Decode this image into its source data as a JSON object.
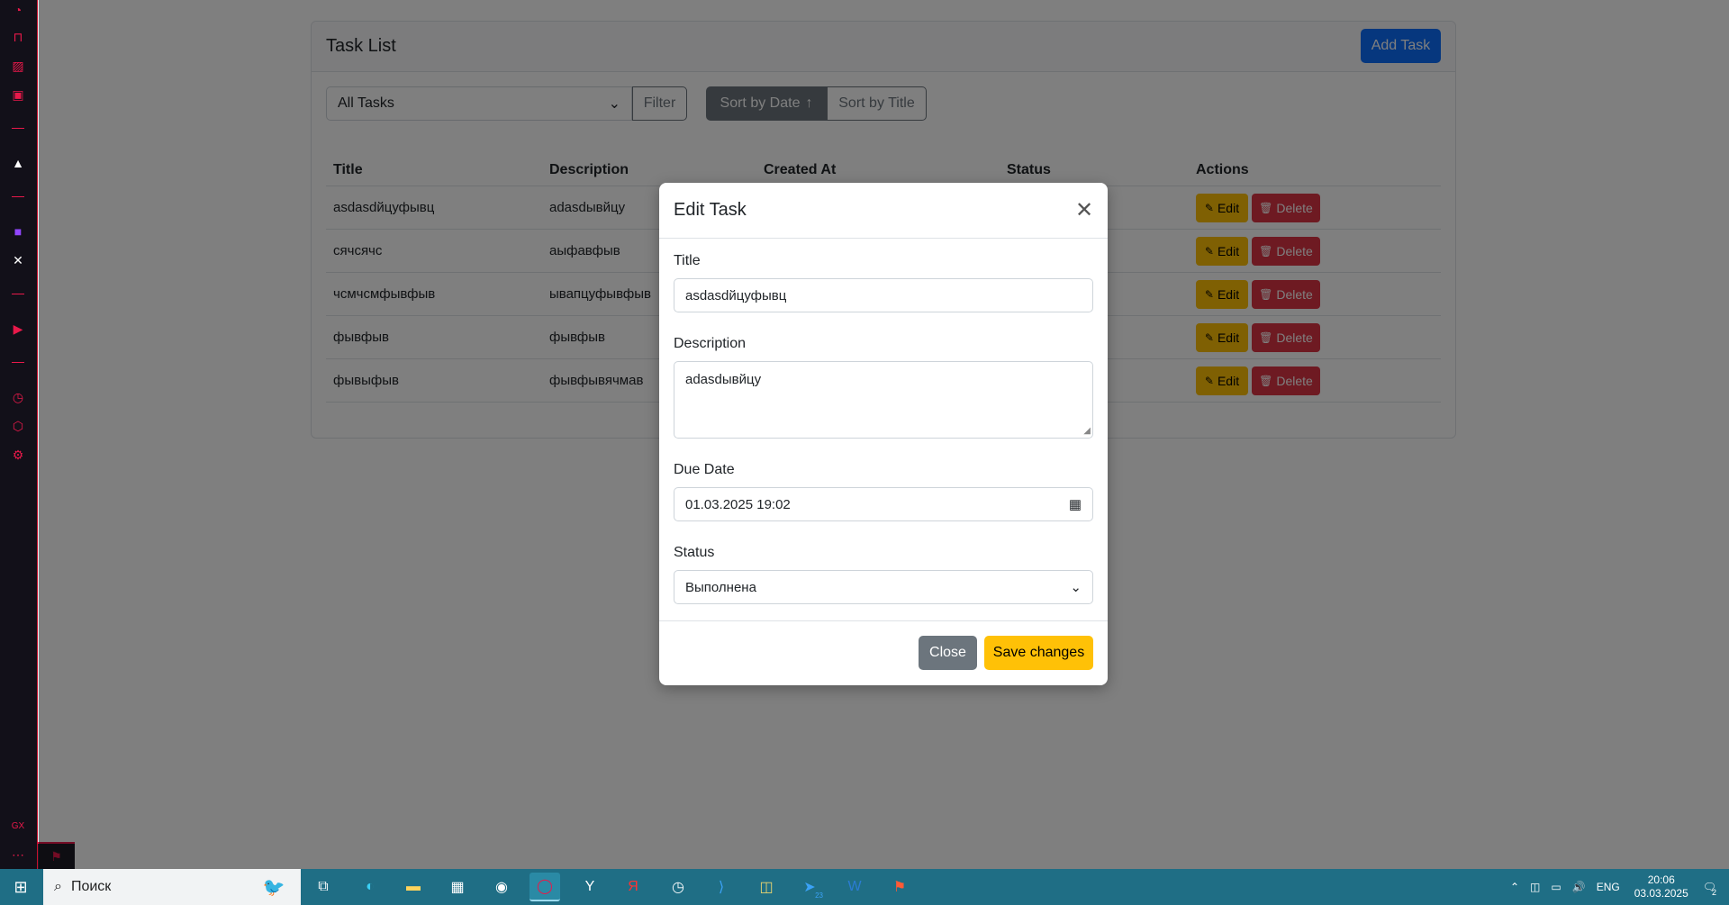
{
  "card": {
    "title": "Task List",
    "add_task_label": "Add Task",
    "filter_select_value": "All Tasks",
    "filter_button_label": "Filter",
    "sort_by_date_label": "Sort by Date",
    "sort_by_date_arrow": "↑",
    "sort_by_title_label": "Sort by Title"
  },
  "table": {
    "headers": [
      "Title",
      "Description",
      "Created At",
      "Status",
      "Actions"
    ],
    "rows": [
      {
        "title": "asdasdйцуфывц",
        "description": "adasdывйцу"
      },
      {
        "title": "сячсячс",
        "description": "аыфавфыв"
      },
      {
        "title": "чсмчсмфывфыв",
        "description": "ывапцуфывфыв"
      },
      {
        "title": "фывфыв",
        "description": "фывфыв"
      },
      {
        "title": "фывыфыв",
        "description": "фывфывячмав"
      }
    ],
    "edit_label": "Edit",
    "delete_label": "Delete"
  },
  "modal": {
    "title": "Edit Task",
    "title_label": "Title",
    "title_value": "asdasdйцуфывц",
    "description_label": "Description",
    "description_value": "adasdывйцу",
    "due_date_label": "Due Date",
    "due_date_value": "01.03.2025 19:02",
    "status_label": "Status",
    "status_value": "Выполнена",
    "close_label": "Close",
    "save_label": "Save changes"
  },
  "taskbar": {
    "search_placeholder": "Поиск",
    "language": "ENG",
    "time": "20:06",
    "date": "03.03.2025",
    "telegram_badge": "23",
    "notification_count": "2"
  },
  "colors": {
    "primary": "#0d6efd",
    "warning": "#ffc107",
    "danger": "#dc3545",
    "secondary": "#6c757d",
    "gx_accent": "#e8194a",
    "taskbar": "#1f6e85"
  }
}
